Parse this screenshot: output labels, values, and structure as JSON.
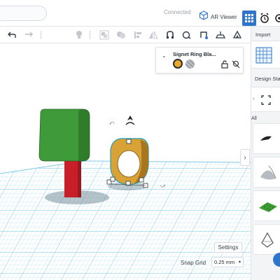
{
  "topbar": {
    "connection_status": "Connected",
    "ar_viewer_label": "AR Viewer"
  },
  "toolbar": {
    "tools": [
      "undo",
      "redo",
      "light-bulb",
      "group",
      "ungroup",
      "align",
      "flip",
      "cruise",
      "ruler",
      "notes",
      "workplane",
      "import-export"
    ]
  },
  "inspector": {
    "title": "Signet Ring Bla...",
    "solid_color": "#E8A92B",
    "hole_color": "#9A9DA3"
  },
  "panel": {
    "import_label": "Import",
    "design_label": "Design Sta",
    "category_label": "All"
  },
  "bottom": {
    "settings_label": "Settings",
    "snap_grid_label": "Snap Grid",
    "snap_grid_value": "0.25 mm"
  },
  "colors": {
    "accent": "#2F75C9",
    "grid": "#7FC9E8",
    "tree_canopy": "#3F9B3A",
    "tree_trunk": "#C81E28",
    "ring": "#D9A237",
    "selection": "#1F9EB8"
  }
}
